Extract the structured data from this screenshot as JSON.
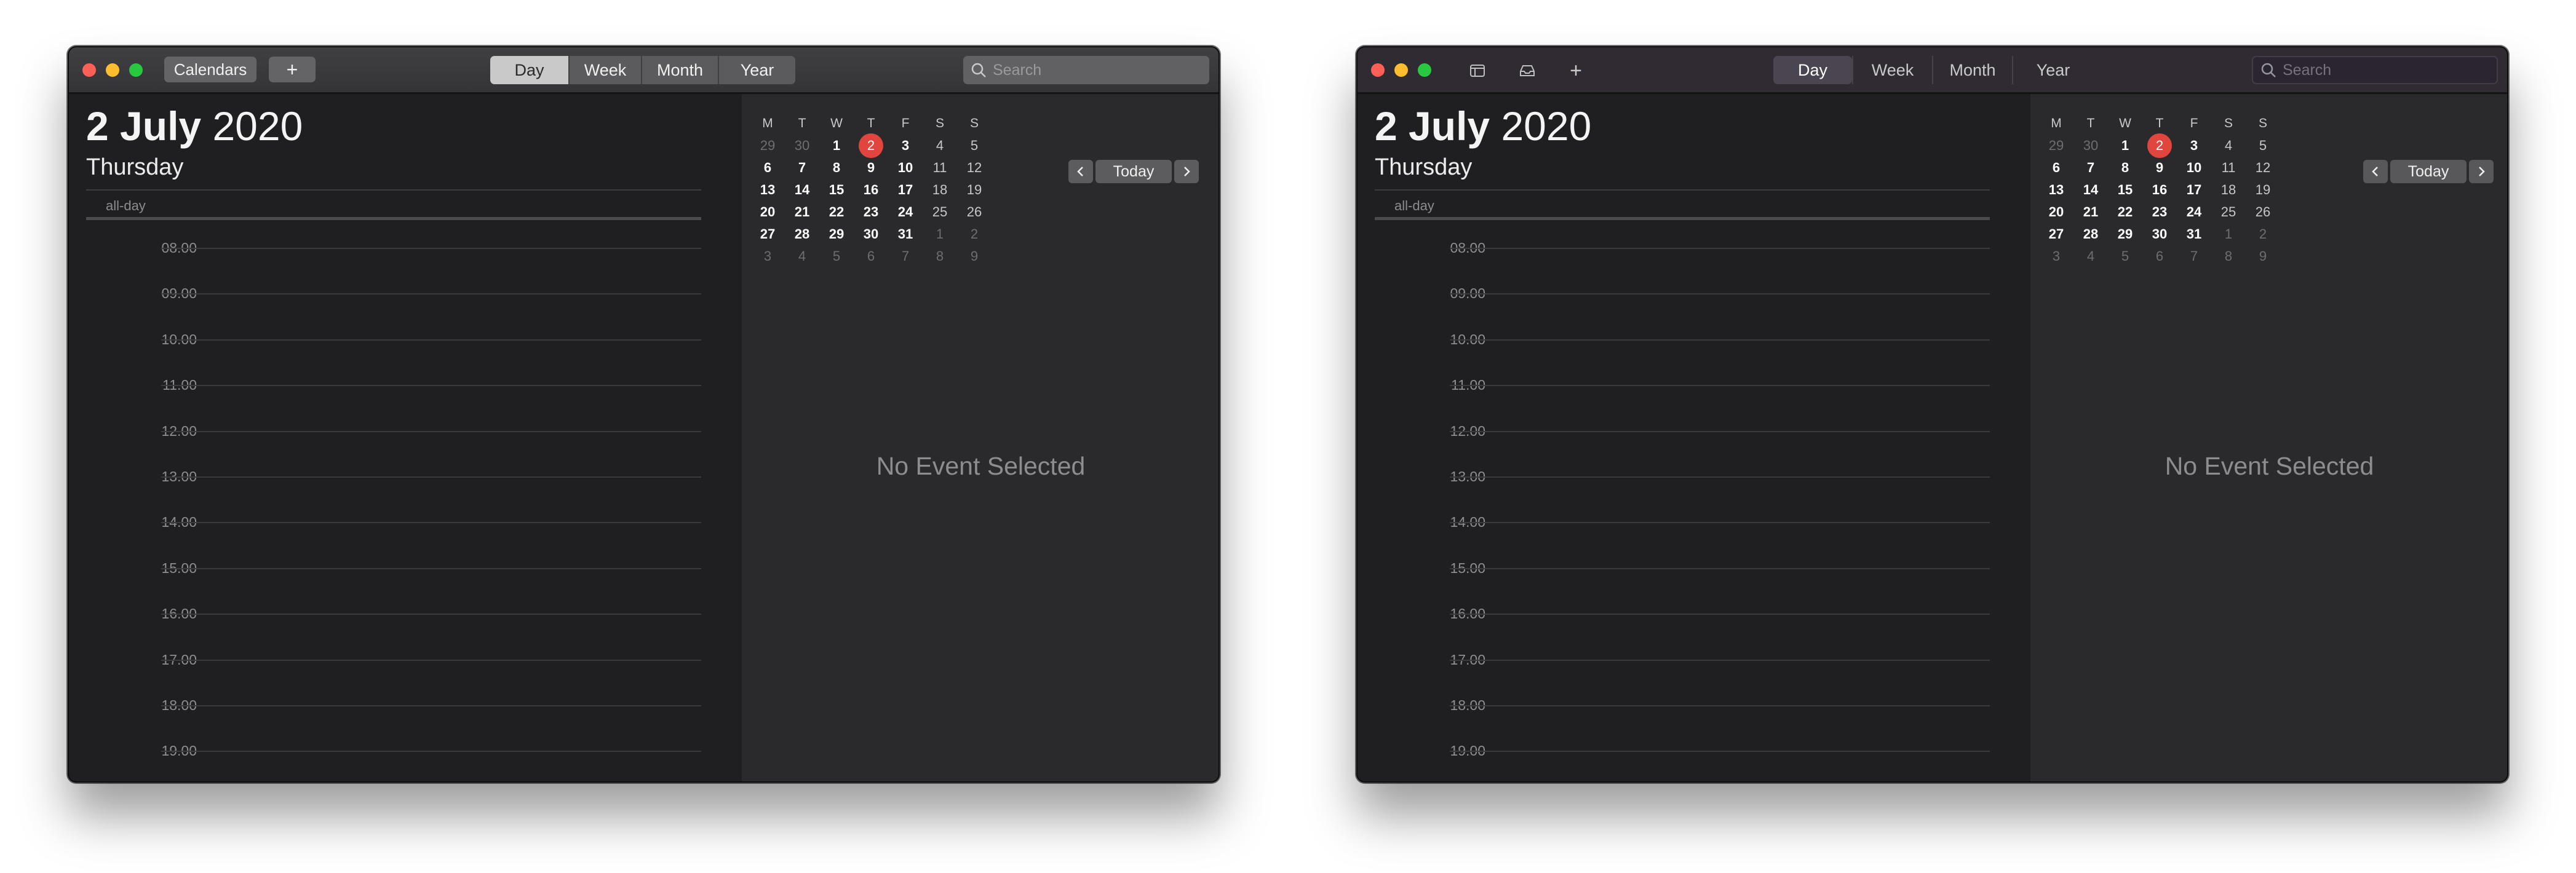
{
  "windows": [
    {
      "variant": "classic",
      "toolbar": {
        "calendars_label": "Calendars",
        "add_label": "+",
        "views": [
          "Day",
          "Week",
          "Month",
          "Year"
        ],
        "active_view": "Day",
        "search_placeholder": "Search"
      },
      "day_header": {
        "day_month": "2 July",
        "year": "2020",
        "weekday": "Thursday"
      },
      "all_day_label": "all-day",
      "hours": [
        "08.00",
        "09.00",
        "10.00",
        "11.00",
        "12.00",
        "13.00",
        "14.00",
        "15.00",
        "16.00",
        "17.00",
        "18.00",
        "19.00"
      ],
      "mini_calendar": {
        "weekday_headers": [
          "M",
          "T",
          "W",
          "T",
          "F",
          "S",
          "S"
        ],
        "weeks": [
          [
            "29",
            "30",
            "1",
            "2",
            "3",
            "4",
            "5"
          ],
          [
            "6",
            "7",
            "8",
            "9",
            "10",
            "11",
            "12"
          ],
          [
            "13",
            "14",
            "15",
            "16",
            "17",
            "18",
            "19"
          ],
          [
            "20",
            "21",
            "22",
            "23",
            "24",
            "25",
            "26"
          ],
          [
            "27",
            "28",
            "29",
            "30",
            "31",
            "1",
            "2"
          ],
          [
            "3",
            "4",
            "5",
            "6",
            "7",
            "8",
            "9"
          ]
        ],
        "today": "2"
      },
      "today_button": "Today",
      "detail_placeholder": "No Event Selected"
    },
    {
      "variant": "big-sur",
      "toolbar": {
        "add_label": "+",
        "views": [
          "Day",
          "Week",
          "Month",
          "Year"
        ],
        "active_view": "Day",
        "search_placeholder": "Search"
      },
      "day_header": {
        "day_month": "2 July",
        "year": "2020",
        "weekday": "Thursday"
      },
      "all_day_label": "all-day",
      "hours": [
        "08.00",
        "09.00",
        "10.00",
        "11.00",
        "12.00",
        "13.00",
        "14.00",
        "15.00",
        "16.00",
        "17.00",
        "18.00",
        "19.00"
      ],
      "mini_calendar": {
        "weekday_headers": [
          "M",
          "T",
          "W",
          "T",
          "F",
          "S",
          "S"
        ],
        "weeks": [
          [
            "29",
            "30",
            "1",
            "2",
            "3",
            "4",
            "5"
          ],
          [
            "6",
            "7",
            "8",
            "9",
            "10",
            "11",
            "12"
          ],
          [
            "13",
            "14",
            "15",
            "16",
            "17",
            "18",
            "19"
          ],
          [
            "20",
            "21",
            "22",
            "23",
            "24",
            "25",
            "26"
          ],
          [
            "27",
            "28",
            "29",
            "30",
            "31",
            "1",
            "2"
          ],
          [
            "3",
            "4",
            "5",
            "6",
            "7",
            "8",
            "9"
          ]
        ],
        "today": "2"
      },
      "today_button": "Today",
      "detail_placeholder": "No Event Selected"
    }
  ],
  "colors": {
    "today_circle": "#e0463d",
    "close": "#fe5f57",
    "minimize": "#febc2e",
    "zoom": "#28c840"
  },
  "icons": {
    "search": "search-icon",
    "calendar_list": "calendar-list-icon",
    "inbox": "inbox-icon",
    "previous": "chevron-left-icon",
    "next": "chevron-right-icon"
  }
}
